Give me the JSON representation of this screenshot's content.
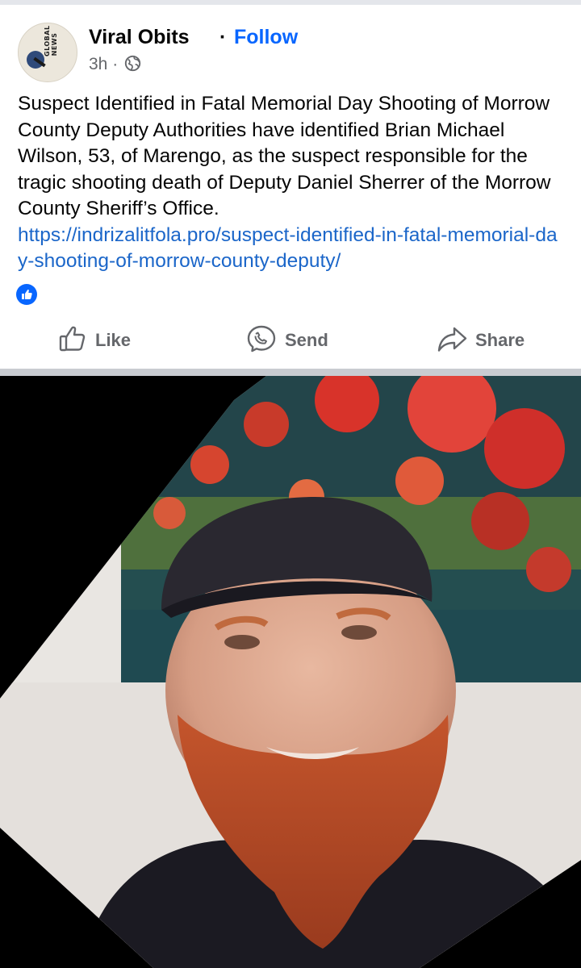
{
  "post": {
    "page_name": "Viral Obits",
    "separator": "·",
    "follow_label": "Follow",
    "time": "3h",
    "time_dot": "·",
    "avatar_text": "GLOBAL NEWS",
    "body_text": "Suspect Identified in Fatal Memorial Day Shooting of Morrow County Deputy Authorities have identified Brian Michael Wilson, 53, of Marengo, as the suspect responsible for the tragic shooting death of Deputy Daniel Sherrer of the Morrow County Sheriff’s Office.",
    "link_text": "https://indrizalitfola.pro/suspect-identified-in-fatal-memorial-day-shooting-of-morrow-county-deputy/"
  },
  "actions": {
    "like_label": "Like",
    "send_label": "Send",
    "share_label": "Share"
  },
  "colors": {
    "accent": "#0866ff",
    "link": "#1b66c9",
    "muted": "#65676b",
    "divider": "#c9ccd1"
  },
  "icons": {
    "privacy": "globe-icon",
    "reaction": "thumbs-up-icon",
    "like": "thumbs-up-outline-icon",
    "send": "messenger-icon",
    "share": "share-arrow-icon"
  }
}
